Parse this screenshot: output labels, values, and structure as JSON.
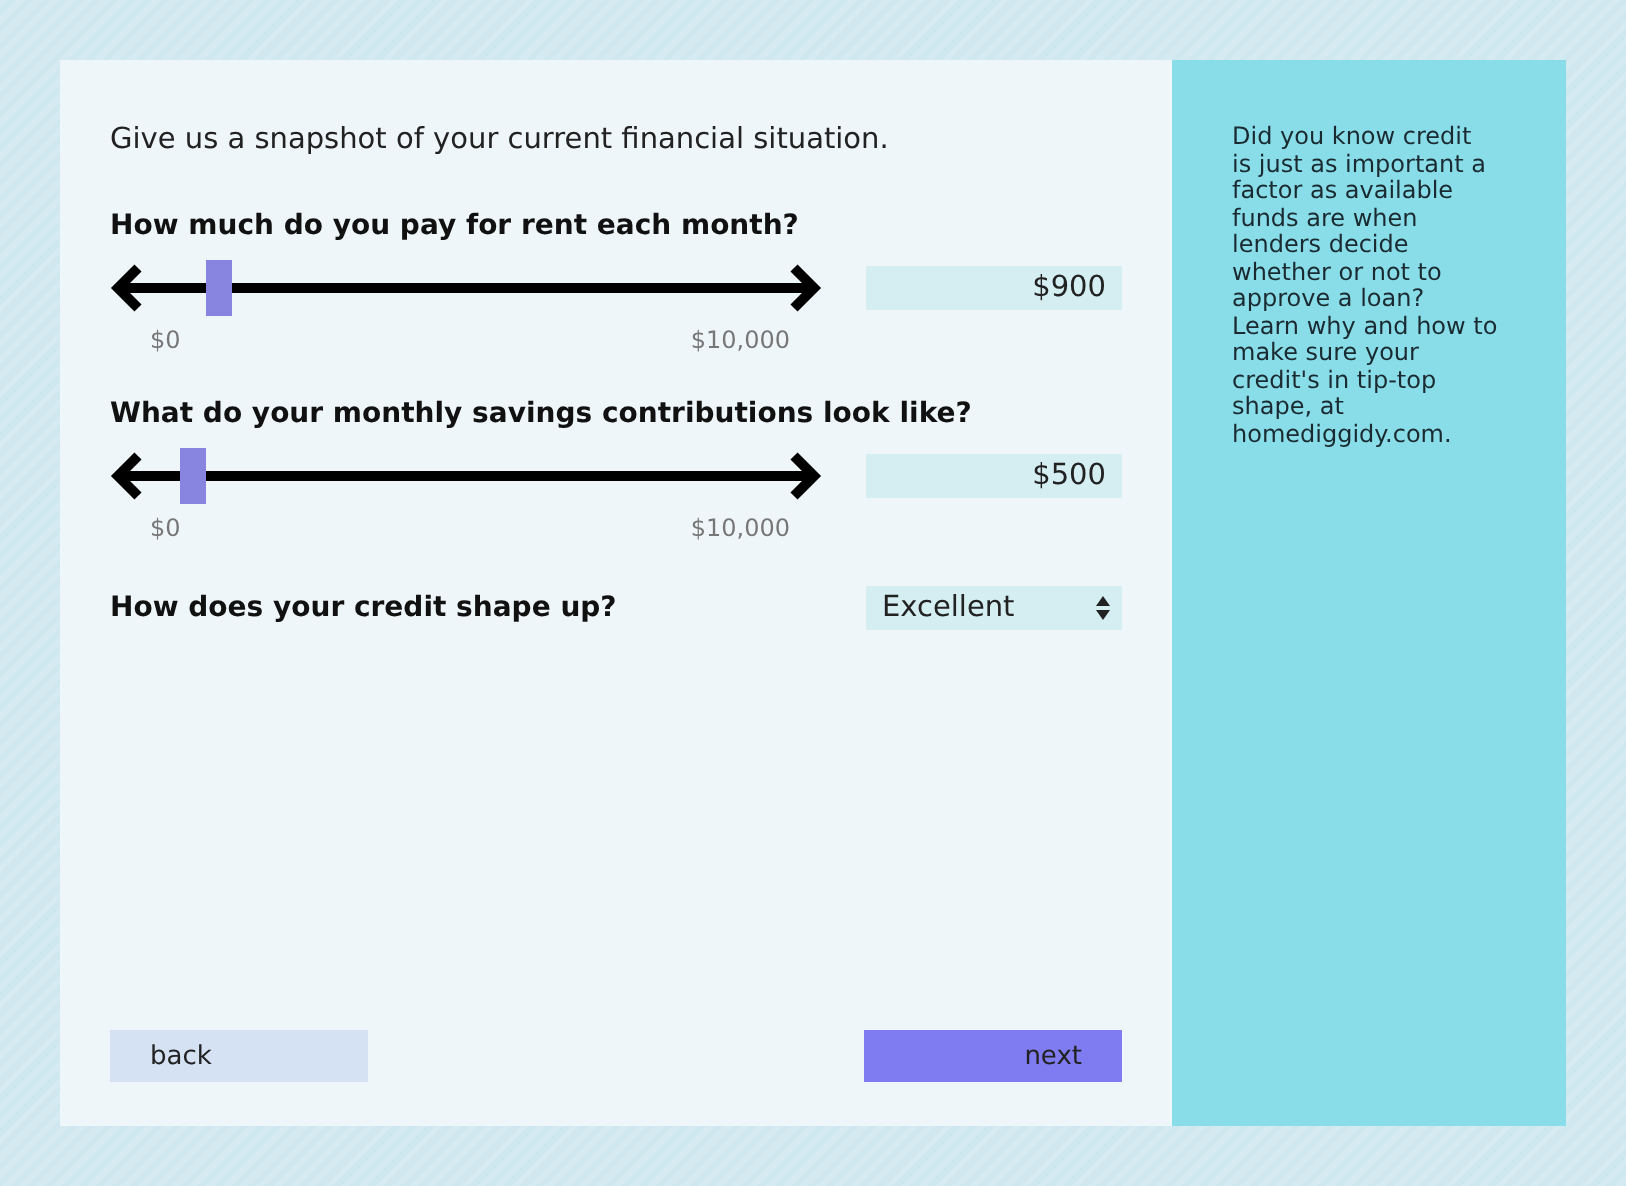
{
  "intro": "Give us a snapshot of your current financial situation.",
  "sliders": [
    {
      "question": "How much do you pay for rent each month?",
      "level": 0.09,
      "min": "$0",
      "max": "$10,000",
      "value": "$900"
    },
    {
      "question": "What do your monthly savings contributions look like?",
      "level": 0.05,
      "min": "$0",
      "max": "$10,000",
      "value": "$500"
    }
  ],
  "credit": {
    "question": "How does your credit shape up?",
    "value": "Excellent"
  },
  "buttons": {
    "back": "back",
    "next": "next"
  },
  "tip": "Did you know credit is just as important a factor as available funds are when lenders decide whether or not to approve a loan? Learn why and how to make sure your credit's in tip-top shape, at homediggidy.com."
}
